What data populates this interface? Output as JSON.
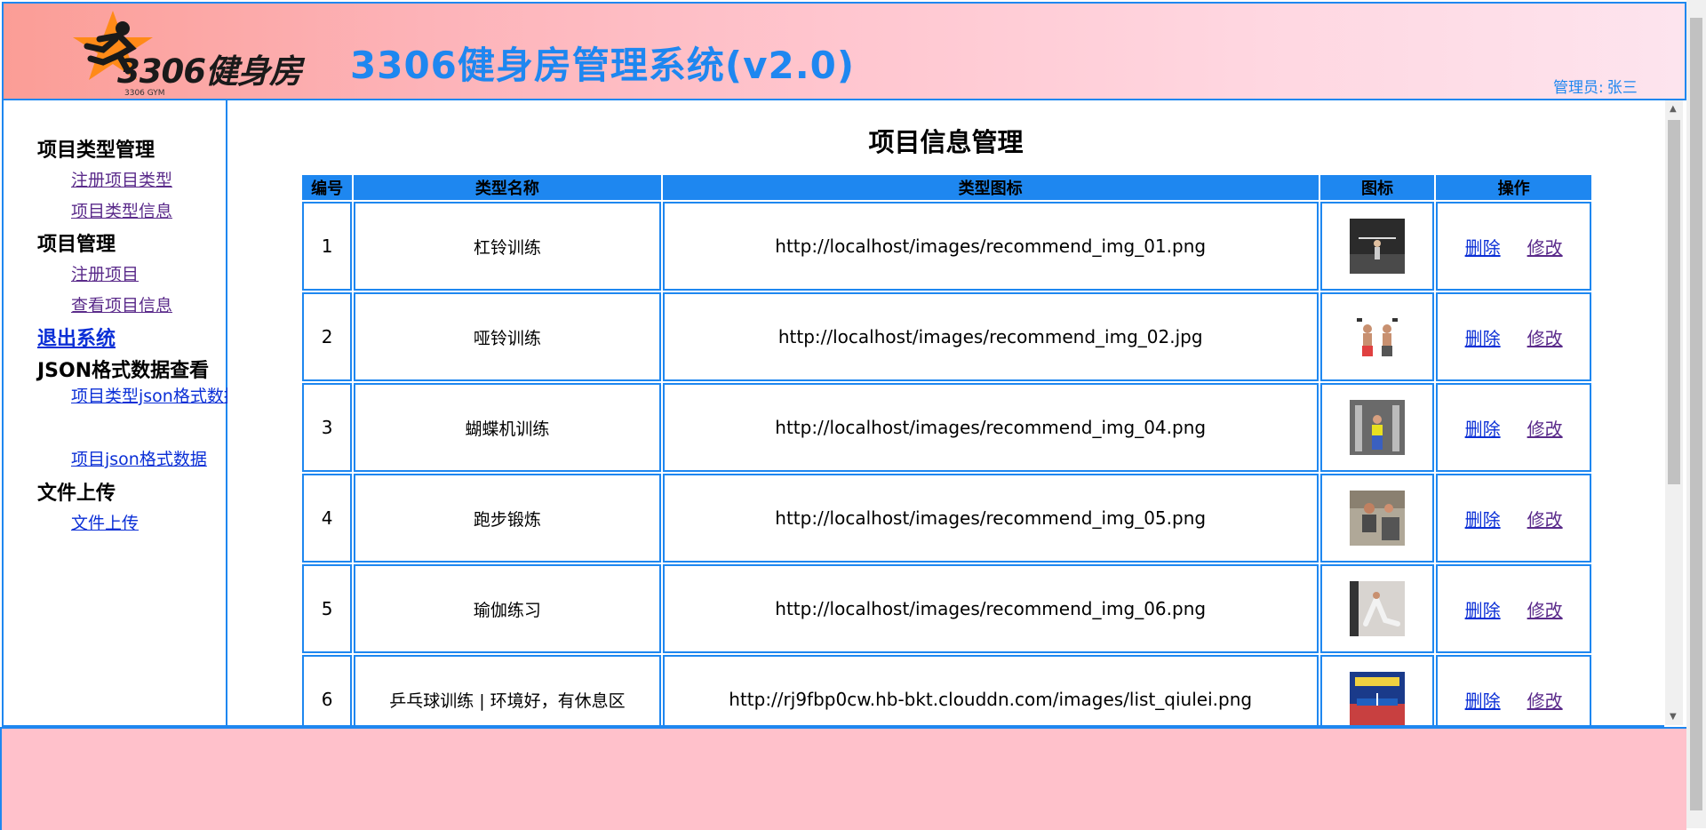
{
  "header": {
    "logo_text": "3306健身房",
    "logo_sub": "3306 GYM",
    "title": "3306健身房管理系统(v2.0)",
    "admin_label": "管理员:",
    "admin_name": "张三",
    "accent_color": "#1e87f0"
  },
  "sidebar": {
    "groups": [
      {
        "title": "项目类型管理",
        "items": [
          "注册项目类型",
          "项目类型信息"
        ]
      },
      {
        "title": "项目管理",
        "items": [
          "注册项目",
          "查看项目信息"
        ]
      },
      {
        "title": "JSON格式数据查看",
        "items": [
          "项目类型json格式数据",
          "项目json格式数据"
        ]
      },
      {
        "title": "文件上传",
        "items": [
          "文件上传"
        ]
      }
    ],
    "logout": "退出系统"
  },
  "main": {
    "title": "项目信息管理",
    "columns": [
      "编号",
      "类型名称",
      "类型图标",
      "图标",
      "操作"
    ],
    "delete_label": "删除",
    "edit_label": "修改",
    "rows": [
      {
        "id": "1",
        "name": "杠铃训练",
        "icon_url": "http://localhost/images/recommend_img_01.png",
        "thumb": "barbell-thumbnail"
      },
      {
        "id": "2",
        "name": "哑铃训练",
        "icon_url": "http://localhost/images/recommend_img_02.jpg",
        "thumb": "dumbbell-thumbnail"
      },
      {
        "id": "3",
        "name": "蝴蝶机训练",
        "icon_url": "http://localhost/images/recommend_img_04.png",
        "thumb": "butterfly-machine-thumbnail"
      },
      {
        "id": "4",
        "name": "跑步锻炼",
        "icon_url": "http://localhost/images/recommend_img_05.png",
        "thumb": "running-thumbnail"
      },
      {
        "id": "5",
        "name": "瑜伽练习",
        "icon_url": "http://localhost/images/recommend_img_06.png",
        "thumb": "yoga-thumbnail"
      },
      {
        "id": "6",
        "name": "乒乓球训练 | 环境好，有休息区",
        "icon_url": "http://rj9fbp0cw.hb-bkt.clouddn.com/images/list_qiulei.png",
        "thumb": "table-tennis-thumbnail"
      }
    ]
  },
  "colors": {
    "header_gradient_start": "#fb9d96",
    "header_gradient_end": "#fde4ee",
    "footer_bg": "#ffc1cb",
    "link_blue": "#0b2fd6",
    "link_visited": "#5a2a8a"
  }
}
